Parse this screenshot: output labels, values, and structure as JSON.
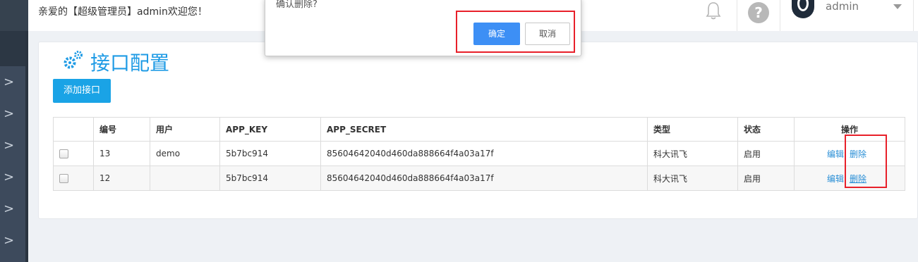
{
  "header": {
    "welcome": "亲爱的【超级管理员】admin欢迎您！",
    "help_symbol": "?",
    "username": "admin"
  },
  "sidebar": {
    "items": [
      ">",
      ">",
      ">",
      ">",
      ">",
      ">"
    ]
  },
  "page": {
    "title": "接口配置",
    "add_button": "添加接口"
  },
  "table": {
    "columns": [
      "",
      "编号",
      "用户",
      "APP_KEY",
      "APP_SECRET",
      "类型",
      "状态",
      "操作"
    ],
    "rows": [
      {
        "id": "13",
        "user": "demo",
        "app_key": "5b7bc914",
        "app_secret": "85604642040d460da888664f4a03a17f",
        "type": "科大讯飞",
        "status": "启用",
        "edit": "编辑",
        "delete": "删除"
      },
      {
        "id": "12",
        "user": "",
        "app_key": "5b7bc914",
        "app_secret": "85604642040d460da888664f4a03a17f",
        "type": "科大讯飞",
        "status": "启用",
        "edit": "编辑",
        "delete": "删除"
      }
    ]
  },
  "dialog": {
    "message": "确认删除?",
    "ok": "确定",
    "cancel": "取消"
  },
  "colors": {
    "accent": "#1aa3e6",
    "title": "#1f9be5",
    "ok_button": "#3d8ff5",
    "highlight": "#e8202a",
    "sidebar": "#3d4a5c"
  }
}
